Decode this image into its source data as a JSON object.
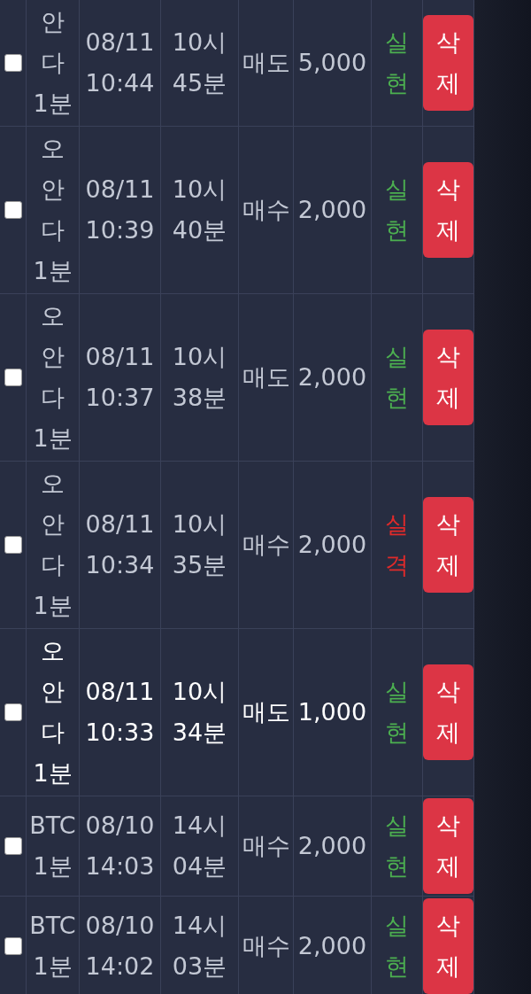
{
  "rows": [
    {
      "checked": false,
      "highlighted": false,
      "symbol": "안다1분",
      "date": "08/11 10:44",
      "time": "10시 45분",
      "side": "매도",
      "amount": "5,000",
      "result": "실현",
      "color": "#4caf50",
      "action": "삭제"
    },
    {
      "checked": false,
      "highlighted": false,
      "symbol": "오안다1분",
      "date": "08/11 10:39",
      "time": "10시 40분",
      "side": "매수",
      "amount": "2,000",
      "result": "실현",
      "color": "#4caf50",
      "action": "삭제"
    },
    {
      "checked": false,
      "highlighted": false,
      "symbol": "오안다1분",
      "date": "08/11 10:37",
      "time": "10시 38분",
      "side": "매도",
      "amount": "2,000",
      "result": "실현",
      "color": "#4caf50",
      "action": "삭제"
    },
    {
      "checked": false,
      "highlighted": false,
      "symbol": "오안다1분",
      "date": "08/11 10:34",
      "time": "10시 35분",
      "side": "매수",
      "amount": "2,000",
      "result": "실격",
      "color": "#e02a2a",
      "action": "삭제"
    },
    {
      "checked": false,
      "highlighted": true,
      "symbol": "오안다1분",
      "date": "08/11 10:33",
      "time": "10시 34분",
      "side": "매도",
      "amount": "1,000",
      "result": "실현",
      "color": "#4caf50",
      "action": "삭제"
    },
    {
      "checked": false,
      "highlighted": false,
      "symbol": "BTC1분",
      "date": "08/10 14:03",
      "time": "14시 04분",
      "side": "매수",
      "amount": "2,000",
      "result": "실현",
      "color": "#4caf50",
      "action": "삭제"
    },
    {
      "checked": false,
      "highlighted": false,
      "symbol": "BTC1분",
      "date": "08/10 14:02",
      "time": "14시 03분",
      "side": "매수",
      "amount": "2,000",
      "result": "실현",
      "color": "#4caf50",
      "action": "삭제"
    }
  ]
}
